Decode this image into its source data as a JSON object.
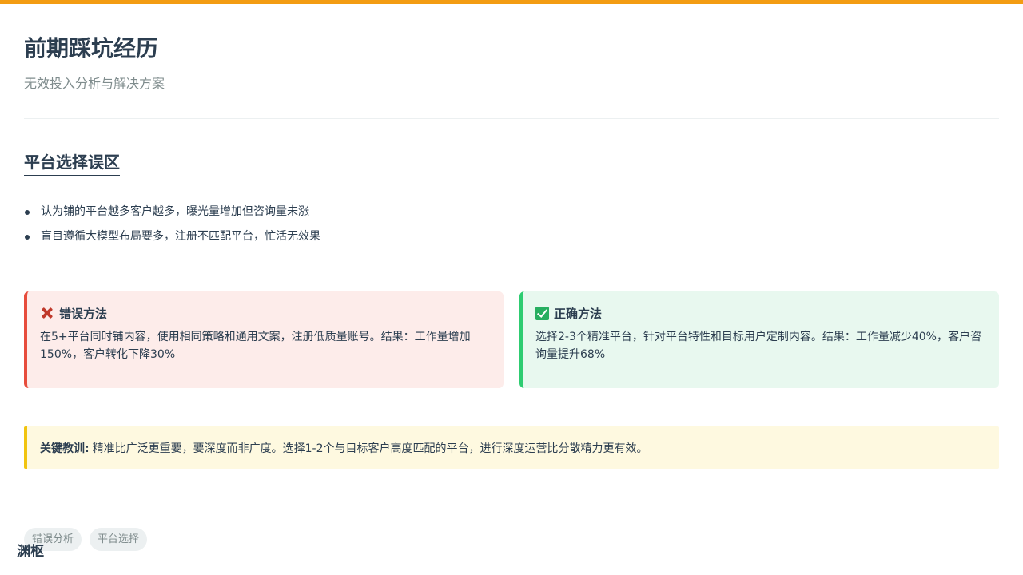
{
  "header": {
    "title": "前期踩坑经历",
    "subtitle": "无效投入分析与解决方案"
  },
  "section": {
    "title": "平台选择误区",
    "bullets": [
      "认为铺的平台越多客户越多，曝光量增加但咨询量未涨",
      "盲目遵循大模型布局要多，注册不匹配平台，忙活无效果"
    ]
  },
  "cards": {
    "wrong": {
      "icon": "cross-mark-icon",
      "title": "错误方法",
      "body": "在5+平台同时铺内容，使用相同策略和通用文案，注册低质量账号。结果：工作量增加150%，客户转化下降30%"
    },
    "right": {
      "icon": "check-mark-icon",
      "title": "正确方法",
      "body": "选择2-3个精准平台，针对平台特性和目标用户定制内容。结果：工作量减少40%，客户咨询量提升68%"
    }
  },
  "lesson": {
    "label": "关键教训:",
    "text": "精准比广泛更重要，要深度而非广度。选择1-2个与目标客户高度匹配的平台，进行深度运营比分散精力更有效。"
  },
  "tags": [
    "错误分析",
    "平台选择"
  ],
  "brand": "渊枢",
  "colors": {
    "accent_bar": "#f39c12",
    "wrong_border": "#e74c3c",
    "right_border": "#2ecc71",
    "lesson_border": "#f1c40f"
  }
}
